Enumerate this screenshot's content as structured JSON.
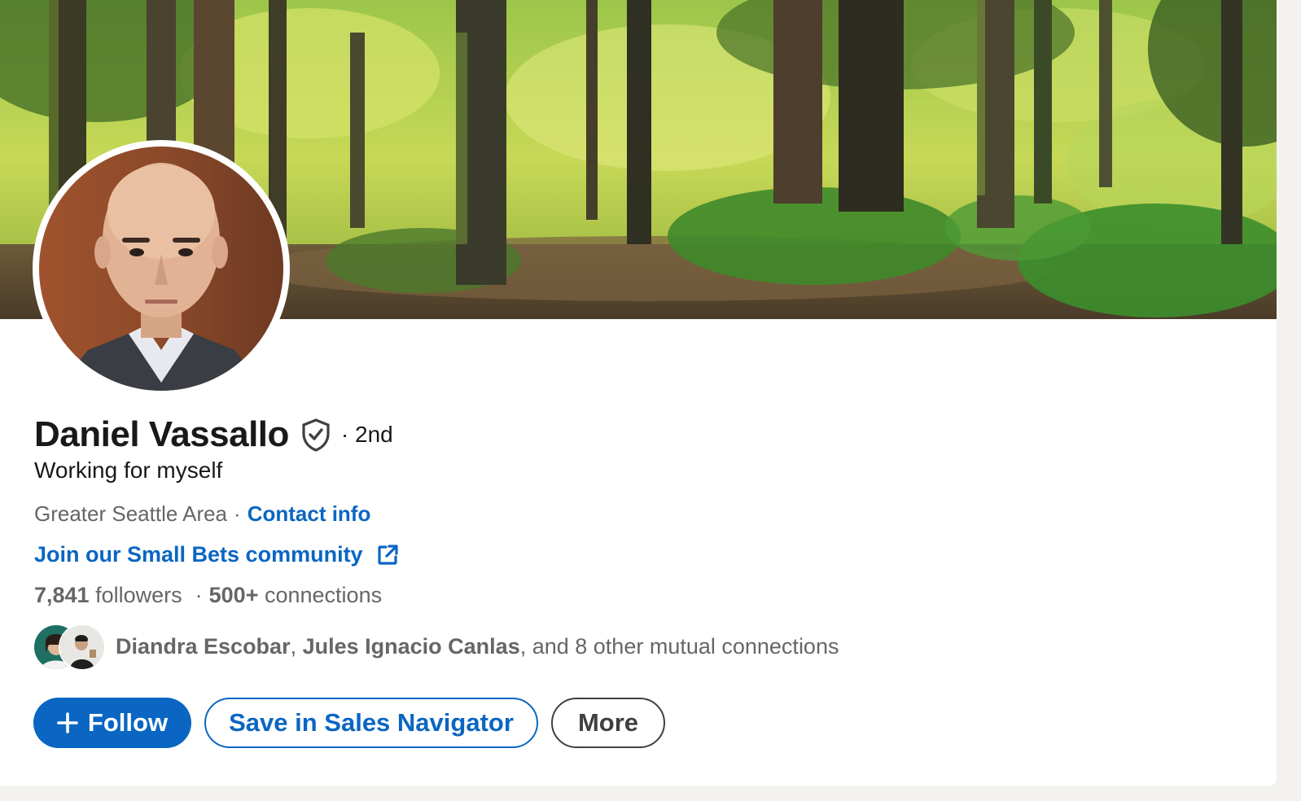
{
  "profile": {
    "name": "Daniel Vassallo",
    "degree": "· 2nd",
    "headline": "Working for myself",
    "location": "Greater Seattle Area",
    "location_separator": "·",
    "contact_info_label": "Contact info",
    "website_link_label": "Join our Small Bets community",
    "followers_count": "7,841",
    "followers_label": "followers",
    "stats_separator": "·",
    "connections_count": "500+",
    "connections_label": "connections"
  },
  "mutual": {
    "name_1": "Diandra Escobar",
    "separator": ",",
    "name_2": "Jules Ignacio Canlas",
    "suffix": ", and 8 other mutual connections"
  },
  "actions": {
    "follow_label": "Follow",
    "save_label": "Save in Sales Navigator",
    "more_label": "More"
  },
  "icons": {
    "verified": "verified-shield-icon",
    "external_link": "external-link-icon",
    "follow_plus": "plus-icon"
  },
  "colors": {
    "accent": "#0a66c2",
    "text_primary": "#191919",
    "text_secondary": "#666666",
    "more_border": "#404040"
  }
}
